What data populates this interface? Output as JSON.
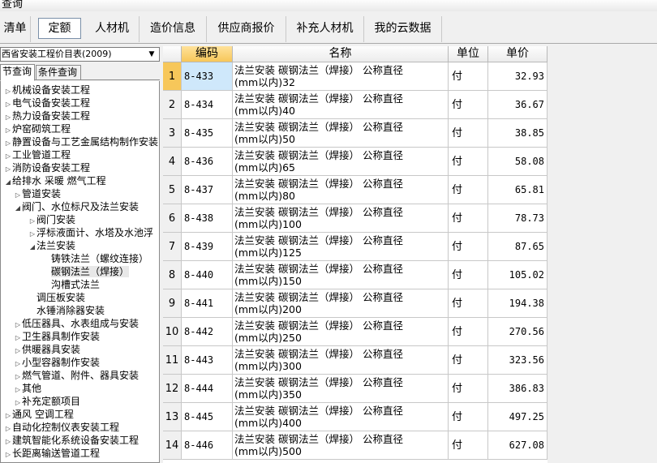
{
  "window": {
    "title": "查询"
  },
  "tabs": [
    {
      "label": "清单"
    },
    {
      "label": "定额"
    },
    {
      "label": "人材机"
    },
    {
      "label": "造价信息"
    },
    {
      "label": "供应商报价"
    },
    {
      "label": "补充人材机"
    },
    {
      "label": "我的云数据"
    }
  ],
  "active_tab": 1,
  "quota_library": {
    "selected": "西省安装工程价目表(2009)"
  },
  "subtabs": [
    {
      "label": "节查询"
    },
    {
      "label": "条件查询"
    }
  ],
  "tree": [
    {
      "label": "机械设备安装工程",
      "level": 0,
      "toggle": "▷"
    },
    {
      "label": "电气设备安装工程",
      "level": 0,
      "toggle": "▷"
    },
    {
      "label": "热力设备安装工程",
      "level": 0,
      "toggle": "▷"
    },
    {
      "label": "炉窑砌筑工程",
      "level": 0,
      "toggle": "▷"
    },
    {
      "label": "静置设备与工艺金属结构制作安装",
      "level": 0,
      "toggle": "▷"
    },
    {
      "label": "工业管道工程",
      "level": 0,
      "toggle": "▷"
    },
    {
      "label": "消防设备安装工程",
      "level": 0,
      "toggle": "▷"
    },
    {
      "label": "给排水 采暖 燃气工程",
      "level": 0,
      "toggle": "◢"
    },
    {
      "label": "管道安装",
      "level": 1,
      "toggle": "▷"
    },
    {
      "label": "阀门、水位标尺及法兰安装",
      "level": 1,
      "toggle": "◢"
    },
    {
      "label": "阀门安装",
      "level": 2,
      "toggle": "▷"
    },
    {
      "label": "浮标液面计、水塔及水池浮",
      "level": 2,
      "toggle": "▷"
    },
    {
      "label": "法兰安装",
      "level": 2,
      "toggle": "◢"
    },
    {
      "label": "铸铁法兰（螺纹连接）",
      "level": 3,
      "toggle": ""
    },
    {
      "label": "碳钢法兰（焊接）",
      "level": 3,
      "toggle": "",
      "selected": true
    },
    {
      "label": "沟槽式法兰",
      "level": 3,
      "toggle": ""
    },
    {
      "label": "调压板安装",
      "level": 2,
      "toggle": ""
    },
    {
      "label": "水锤消除器安装",
      "level": 2,
      "toggle": ""
    },
    {
      "label": "低压器具、水表组成与安装",
      "level": 1,
      "toggle": "▷"
    },
    {
      "label": "卫生器具制作安装",
      "level": 1,
      "toggle": "▷"
    },
    {
      "label": "供暖器具安装",
      "level": 1,
      "toggle": "▷"
    },
    {
      "label": "小型容器制作安装",
      "level": 1,
      "toggle": "▷"
    },
    {
      "label": "燃气管道、附件、器具安装",
      "level": 1,
      "toggle": "▷"
    },
    {
      "label": "其他",
      "level": 1,
      "toggle": "▷"
    },
    {
      "label": "补充定额项目",
      "level": 1,
      "toggle": "▷"
    },
    {
      "label": "通风 空调工程",
      "level": 0,
      "toggle": "▷"
    },
    {
      "label": "自动化控制仪表安装工程",
      "level": 0,
      "toggle": "▷"
    },
    {
      "label": "建筑智能化系统设备安装工程",
      "level": 0,
      "toggle": "▷"
    },
    {
      "label": "长距离输送管道工程",
      "level": 0,
      "toggle": "▷"
    }
  ],
  "grid": {
    "headers": {
      "index": "",
      "code": "编码",
      "name": "名称",
      "unit": "单位",
      "price": "单价"
    },
    "rows": [
      {
        "index": "1",
        "code": "8-433",
        "name1": "法兰安装 碳钢法兰（焊接） 公称直径",
        "name2": "(mm以内)32",
        "unit": "付",
        "price": "32.93"
      },
      {
        "index": "2",
        "code": "8-434",
        "name1": "法兰安装 碳钢法兰（焊接） 公称直径",
        "name2": "(mm以内)40",
        "unit": "付",
        "price": "36.67"
      },
      {
        "index": "3",
        "code": "8-435",
        "name1": "法兰安装 碳钢法兰（焊接） 公称直径",
        "name2": "(mm以内)50",
        "unit": "付",
        "price": "38.85"
      },
      {
        "index": "4",
        "code": "8-436",
        "name1": "法兰安装 碳钢法兰（焊接） 公称直径",
        "name2": "(mm以内)65",
        "unit": "付",
        "price": "58.08"
      },
      {
        "index": "5",
        "code": "8-437",
        "name1": "法兰安装 碳钢法兰（焊接） 公称直径",
        "name2": "(mm以内)80",
        "unit": "付",
        "price": "65.81"
      },
      {
        "index": "6",
        "code": "8-438",
        "name1": "法兰安装 碳钢法兰（焊接） 公称直径",
        "name2": "(mm以内)100",
        "unit": "付",
        "price": "78.73"
      },
      {
        "index": "7",
        "code": "8-439",
        "name1": "法兰安装 碳钢法兰（焊接） 公称直径",
        "name2": "(mm以内)125",
        "unit": "付",
        "price": "87.65"
      },
      {
        "index": "8",
        "code": "8-440",
        "name1": "法兰安装 碳钢法兰（焊接） 公称直径",
        "name2": "(mm以内)150",
        "unit": "付",
        "price": "105.02"
      },
      {
        "index": "9",
        "code": "8-441",
        "name1": "法兰安装 碳钢法兰（焊接） 公称直径",
        "name2": "(mm以内)200",
        "unit": "付",
        "price": "194.38"
      },
      {
        "index": "10",
        "code": "8-442",
        "name1": "法兰安装 碳钢法兰（焊接） 公称直径",
        "name2": "(mm以内)250",
        "unit": "付",
        "price": "270.56"
      },
      {
        "index": "11",
        "code": "8-443",
        "name1": "法兰安装 碳钢法兰（焊接） 公称直径",
        "name2": "(mm以内)300",
        "unit": "付",
        "price": "323.56"
      },
      {
        "index": "12",
        "code": "8-444",
        "name1": "法兰安装 碳钢法兰（焊接） 公称直径",
        "name2": "(mm以内)350",
        "unit": "付",
        "price": "386.83"
      },
      {
        "index": "13",
        "code": "8-445",
        "name1": "法兰安装 碳钢法兰（焊接） 公称直径",
        "name2": "(mm以内)400",
        "unit": "付",
        "price": "497.25"
      },
      {
        "index": "14",
        "code": "8-446",
        "name1": "法兰安装 碳钢法兰（焊接） 公称直径",
        "name2": "(mm以内)500",
        "unit": "付",
        "price": "627.08"
      }
    ]
  }
}
